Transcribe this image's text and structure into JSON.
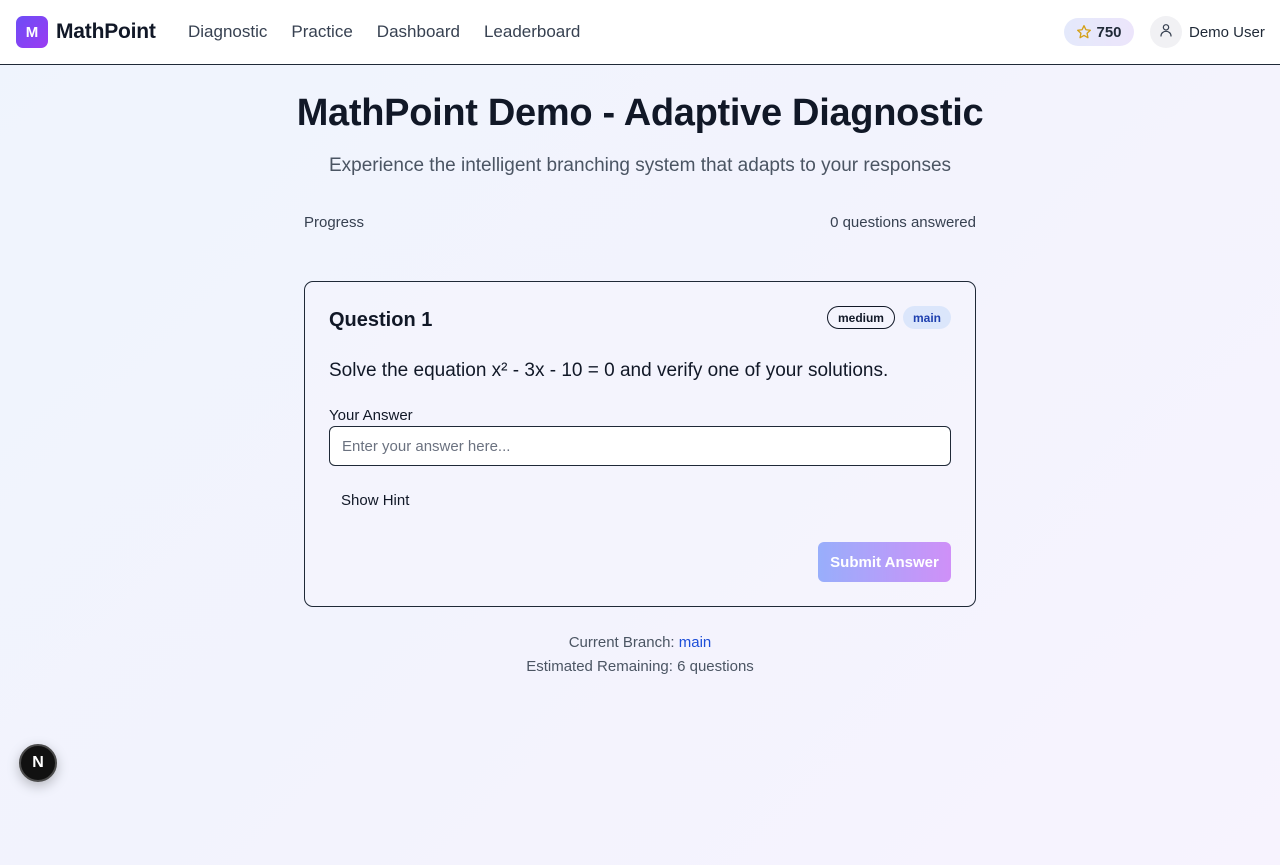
{
  "brand": {
    "logo_letter": "M",
    "name": "MathPoint"
  },
  "nav": {
    "items": [
      "Diagnostic",
      "Practice",
      "Dashboard",
      "Leaderboard"
    ]
  },
  "header": {
    "points": "750",
    "user_name": "Demo User"
  },
  "main": {
    "title": "MathPoint Demo - Adaptive Diagnostic",
    "subtitle": "Experience the intelligent branching system that adapts to your responses",
    "progress_label": "Progress",
    "progress_count": "0 questions answered"
  },
  "question": {
    "title": "Question 1",
    "difficulty_badge": "medium",
    "branch_badge": "main",
    "text": "Solve the equation x² - 3x - 10 = 0 and verify one of your solutions.",
    "answer_label": "Your Answer",
    "answer_value": "",
    "answer_placeholder": "Enter your answer here...",
    "hint_label": "Show Hint",
    "submit_label": "Submit Answer"
  },
  "footer": {
    "branch_label": "Current Branch:",
    "branch_value": "main",
    "remaining": "Estimated Remaining: 6 questions"
  },
  "dev_badge": {
    "letter": "N"
  },
  "colors": {
    "accent_start": "#6d4df6",
    "accent_end": "#9b3bf2",
    "link_blue": "#1d4ed8",
    "star": "#d4a017"
  }
}
